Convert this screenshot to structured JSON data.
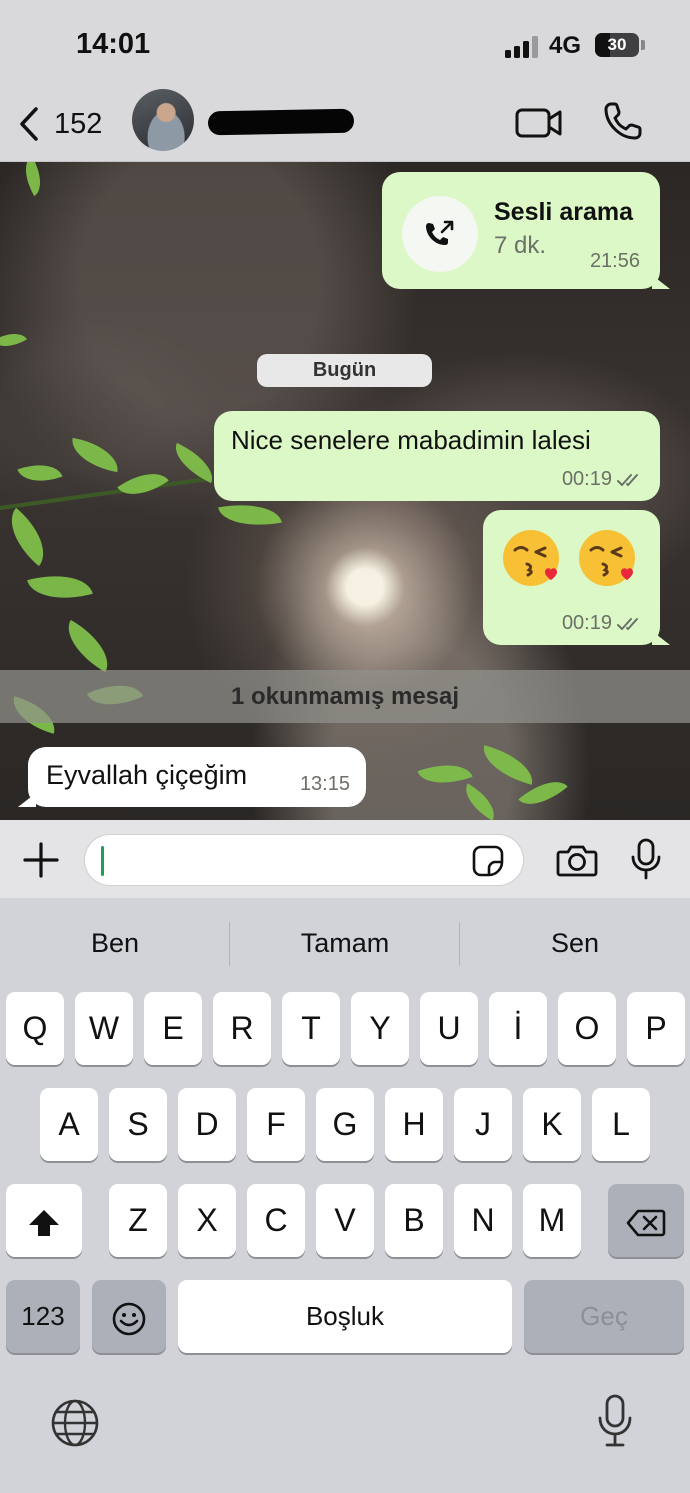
{
  "status_bar": {
    "time": "14:01",
    "network": "4G",
    "battery": "30",
    "battery_level_percent": 30
  },
  "header": {
    "back_count": "152",
    "contact_name": "",
    "icons": [
      "chevron-left-icon",
      "video-icon",
      "phone-icon"
    ]
  },
  "chat": {
    "call": {
      "title": "Sesli arama",
      "duration": "7 dk.",
      "time": "21:56"
    },
    "date_divider": "Bugün",
    "messages": [
      {
        "direction": "out",
        "text": "Nice senelere mabadimin lalesi",
        "time": "00:19",
        "status": "read"
      },
      {
        "direction": "out",
        "text": "😘😘",
        "time": "00:19",
        "status": "read"
      },
      {
        "direction": "in",
        "text": "Eyvallah çiçeğim",
        "time": "13:15"
      }
    ],
    "unread_banner": "1 okunmamış mesaj"
  },
  "input": {
    "value": "",
    "icons": [
      "plus-icon",
      "sticker-icon",
      "camera-icon",
      "microphone-icon"
    ]
  },
  "keyboard": {
    "suggestions": [
      "Ben",
      "Tamam",
      "Sen"
    ],
    "row1": [
      "Q",
      "W",
      "E",
      "R",
      "T",
      "Y",
      "U",
      "İ",
      "O",
      "P"
    ],
    "row2": [
      "A",
      "S",
      "D",
      "F",
      "G",
      "H",
      "J",
      "K",
      "L"
    ],
    "row3": [
      "Z",
      "X",
      "C",
      "V",
      "B",
      "N",
      "M"
    ],
    "numbers_label": "123",
    "space_label": "Boşluk",
    "return_label": "Geç",
    "colors": {
      "background": "#d1d3d9",
      "key": "#ffffff",
      "special_key": "#acb0b9",
      "bubble_out": "#dcf8c6",
      "bubble_in": "#ffffff"
    }
  }
}
